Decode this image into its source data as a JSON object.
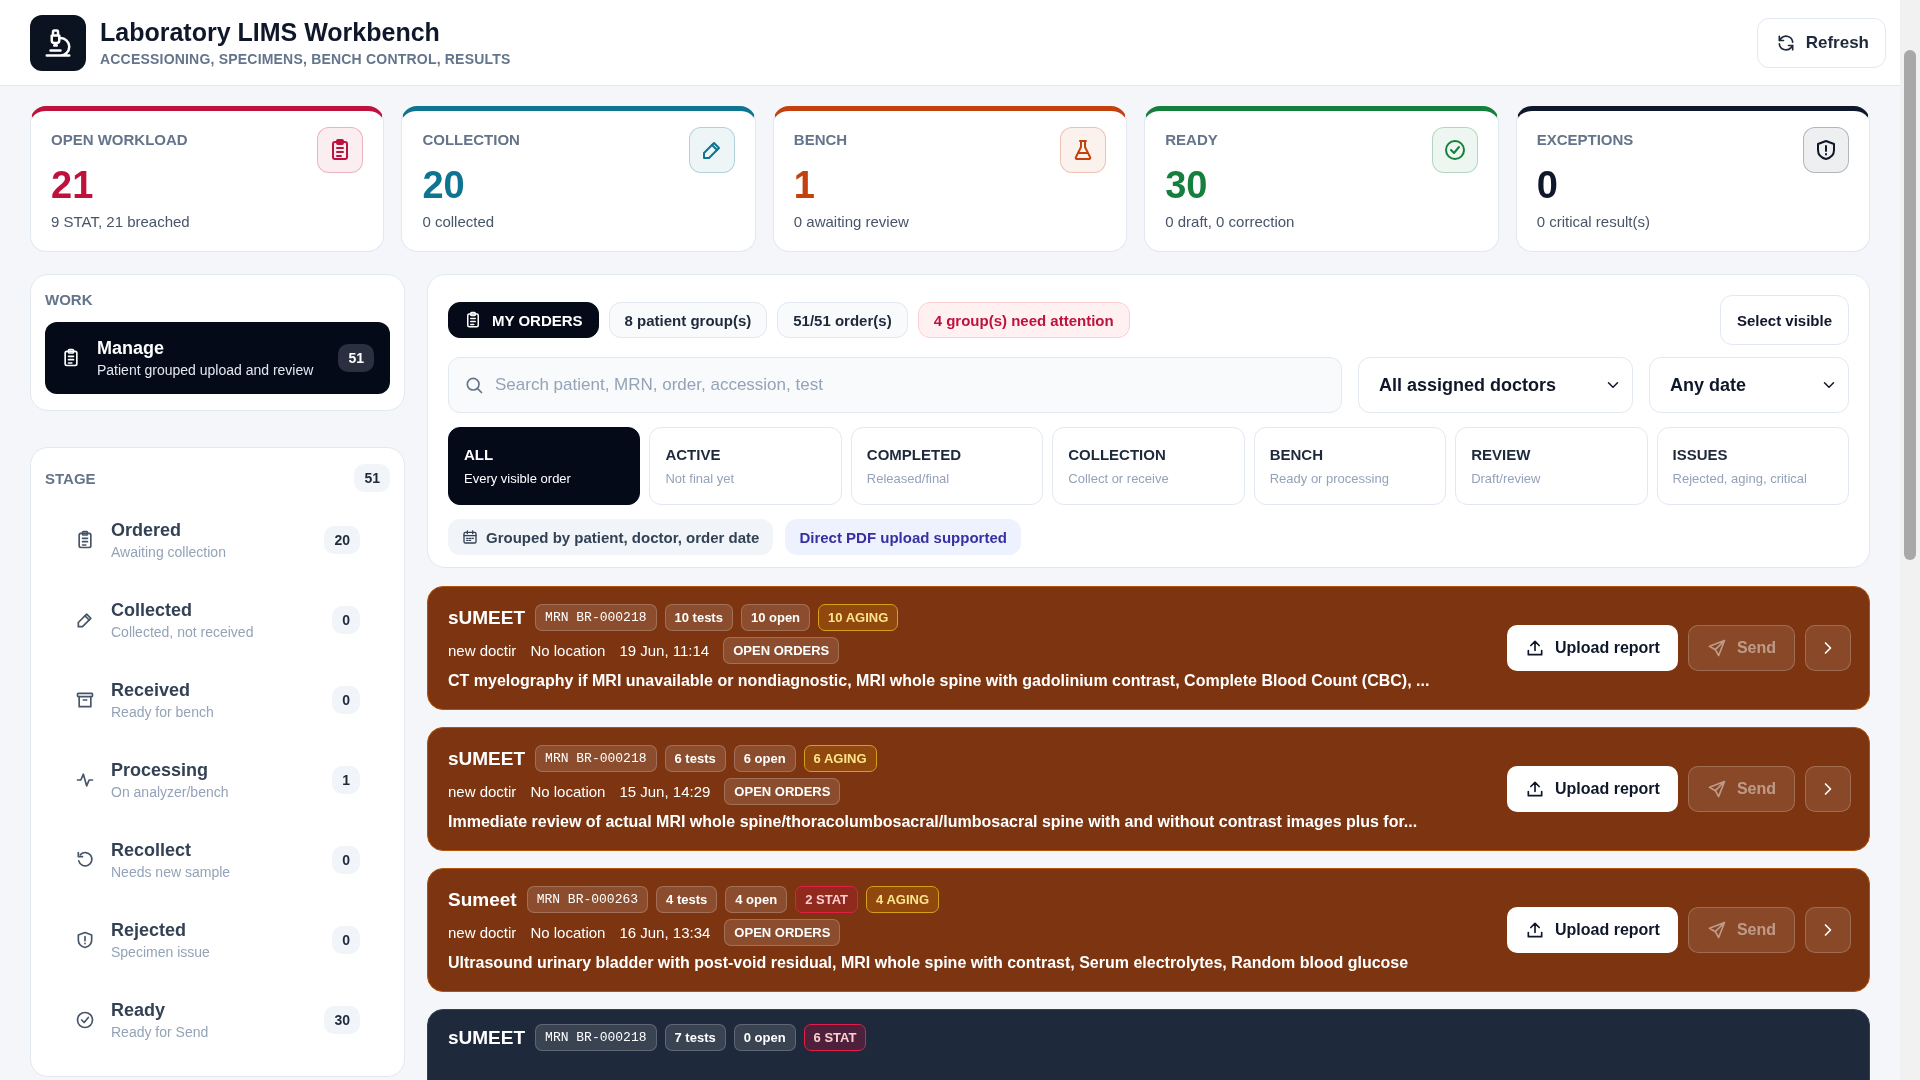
{
  "header": {
    "title": "Laboratory LIMS Workbench",
    "subtitle": "ACCESSIONING, SPECIMENS, BENCH CONTROL, RESULTS",
    "refresh": "Refresh"
  },
  "stats": [
    {
      "label": "OPEN WORKLOAD",
      "value": "21",
      "detail": "9 STAT, 21 breached",
      "color": "#be123c"
    },
    {
      "label": "COLLECTION",
      "value": "20",
      "detail": "0 collected",
      "color": "#0e7490"
    },
    {
      "label": "BENCH",
      "value": "1",
      "detail": "0 awaiting review",
      "color": "#c2410c"
    },
    {
      "label": "READY",
      "value": "30",
      "detail": "0 draft, 0 correction",
      "color": "#15803d"
    },
    {
      "label": "EXCEPTIONS",
      "value": "0",
      "detail": "0 critical result(s)",
      "color": "#0f172a"
    }
  ],
  "work": {
    "title": "WORK",
    "items": [
      {
        "label": "Manage",
        "description": "Patient grouped upload and review",
        "count": "51",
        "selected": true
      }
    ]
  },
  "stage": {
    "title": "STAGE",
    "count": "51",
    "items": [
      {
        "label": "Ordered",
        "description": "Awaiting collection",
        "count": "20",
        "selected": false
      },
      {
        "label": "Collected",
        "description": "Collected, not received",
        "count": "0",
        "selected": false
      },
      {
        "label": "Received",
        "description": "Ready for bench",
        "count": "0",
        "selected": false
      },
      {
        "label": "Processing",
        "description": "On analyzer/bench",
        "count": "1",
        "selected": false
      },
      {
        "label": "Recollect",
        "description": "Needs new sample",
        "count": "0",
        "selected": false
      },
      {
        "label": "Rejected",
        "description": "Specimen issue",
        "count": "0",
        "selected": false
      },
      {
        "label": "Ready",
        "description": "Ready for Send",
        "count": "30",
        "selected": false
      }
    ]
  },
  "toolbar": {
    "chips": [
      {
        "text": "MY ORDERS",
        "kind": "primary"
      },
      {
        "text": "8 patient group(s)",
        "kind": "plain"
      },
      {
        "text": "51/51 order(s)",
        "kind": "plain"
      },
      {
        "text": "4 group(s) need attention",
        "kind": "alert"
      }
    ],
    "select_visible": "Select visible"
  },
  "search": {
    "placeholder": "Search patient, MRN, order, accession, test"
  },
  "doctor_filter": {
    "value": "All assigned doctors"
  },
  "date_filter": {
    "value": "Any date"
  },
  "filter_tabs": [
    {
      "label": "ALL",
      "description": "Every visible order",
      "selected": true
    },
    {
      "label": "ACTIVE",
      "description": "Not final yet",
      "selected": false
    },
    {
      "label": "COMPLETED",
      "description": "Released/final",
      "selected": false
    },
    {
      "label": "COLLECTION",
      "description": "Collect or receive",
      "selected": false
    },
    {
      "label": "BENCH",
      "description": "Ready or processing",
      "selected": false
    },
    {
      "label": "REVIEW",
      "description": "Draft/review",
      "selected": false
    },
    {
      "label": "ISSUES",
      "description": "Rejected, aging, critical",
      "selected": false
    }
  ],
  "notes": [
    {
      "text": "Grouped by patient, doctor, order date",
      "kind": "grouping"
    },
    {
      "text": "Direct PDF upload supported",
      "kind": "info"
    }
  ],
  "orders": [
    {
      "kind": "attention",
      "patient": "sUMEET",
      "badges": [
        {
          "text": "MRN BR-000218",
          "kind": "mrn"
        },
        {
          "text": "10 tests",
          "kind": "count"
        },
        {
          "text": "10 open",
          "kind": "count"
        },
        {
          "text": "10 AGING",
          "kind": "aging"
        }
      ],
      "doctor": "new doctir",
      "location": "No location",
      "date": "19 Jun, 11:14",
      "status": "OPEN ORDERS",
      "tests": "CT myelography if MRI unavailable or nondiagnostic, MRI whole spine with gadolinium contrast, Complete Blood Count (CBC), ...",
      "upload": "Upload report",
      "send": {
        "label": "Send",
        "disabled": true
      }
    },
    {
      "kind": "attention",
      "patient": "sUMEET",
      "badges": [
        {
          "text": "MRN BR-000218",
          "kind": "mrn"
        },
        {
          "text": "6 tests",
          "kind": "count"
        },
        {
          "text": "6 open",
          "kind": "count"
        },
        {
          "text": "6 AGING",
          "kind": "aging"
        }
      ],
      "doctor": "new doctir",
      "location": "No location",
      "date": "15 Jun, 14:29",
      "status": "OPEN ORDERS",
      "tests": "Immediate review of actual MRI whole spine/thoracolumbosacral/lumbosacral spine with and without contrast images plus for...",
      "upload": "Upload report",
      "send": {
        "label": "Send",
        "disabled": true
      }
    },
    {
      "kind": "attention",
      "patient": "Sumeet",
      "badges": [
        {
          "text": "MRN BR-000263",
          "kind": "mrn"
        },
        {
          "text": "4 tests",
          "kind": "count"
        },
        {
          "text": "4 open",
          "kind": "count"
        },
        {
          "text": "2 STAT",
          "kind": "stat"
        },
        {
          "text": "4 AGING",
          "kind": "aging"
        }
      ],
      "doctor": "new doctir",
      "location": "No location",
      "date": "16 Jun, 13:34",
      "status": "OPEN ORDERS",
      "tests": "Ultrasound urinary bladder with post-void residual, MRI whole spine with contrast, Serum electrolytes, Random blood glucose",
      "upload": "Upload report",
      "send": {
        "label": "Send",
        "disabled": true
      }
    },
    {
      "kind": "released",
      "patient": "sUMEET",
      "badges": [
        {
          "text": "MRN BR-000218",
          "kind": "mrn"
        },
        {
          "text": "7 tests",
          "kind": "count"
        },
        {
          "text": "0 open",
          "kind": "count"
        },
        {
          "text": "6 STAT",
          "kind": "stat"
        }
      ]
    }
  ]
}
